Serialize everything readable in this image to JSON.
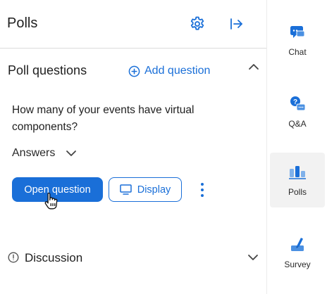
{
  "header": {
    "title": "Polls",
    "settings_icon": "gear-icon",
    "collapse_icon": "collapse-panel-icon"
  },
  "poll_questions": {
    "title": "Poll questions",
    "add_question_label": "Add question",
    "question_text": "How many of your events have virtual components?",
    "answers_label": "Answers",
    "open_question_label": "Open question",
    "display_label": "Display"
  },
  "discussion": {
    "label": "Discussion"
  },
  "rail": {
    "items": [
      {
        "label": "Chat",
        "icon": "chat-icon"
      },
      {
        "label": "Q&A",
        "icon": "qa-icon"
      },
      {
        "label": "Polls",
        "icon": "polls-icon",
        "active": true
      },
      {
        "label": "Survey",
        "icon": "survey-icon"
      }
    ]
  },
  "colors": {
    "accent": "#1a6fd8",
    "active_rail_bg": "#f2f2f2",
    "divider": "#dcdcdc"
  }
}
